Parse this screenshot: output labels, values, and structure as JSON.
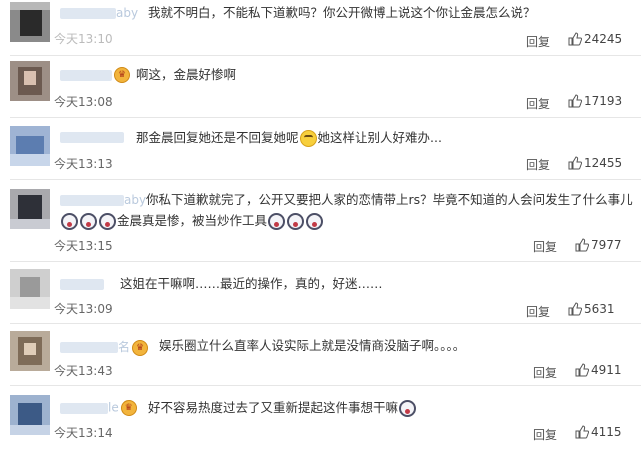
{
  "comments": [
    {
      "user": "aby",
      "vip": false,
      "text_parts": [
        "我就不明白，不能私下道歉吗？你公开微博上说这个你让金晨怎么说？"
      ],
      "emojis_after": [],
      "time": "今天13:10",
      "reply": "回复",
      "likes": "24245"
    },
    {
      "user": "",
      "vip": true,
      "text_parts": [
        "啊这，金晨好惨啊"
      ],
      "emojis_after": [],
      "time": "今天13:08",
      "reply": "回复",
      "likes": "17193"
    },
    {
      "user": "",
      "vip": false,
      "text_parts": [
        "那金晨回复她还是不回复她呢",
        "她这样让别人好难办..."
      ],
      "emojis_after": [],
      "time": "今天13:13",
      "reply": "回复",
      "likes": "12455"
    },
    {
      "user": "aby",
      "vip": false,
      "text_parts": [
        "你私下道歉就完了，公开又要把人家的恋情带上rs？毕竟不知道的人会问发生了什么事儿",
        "金晨真是惨，被当炒作工具"
      ],
      "emojis_after": [],
      "time": "今天13:15",
      "reply": "回复",
      "likes": "7977"
    },
    {
      "user": "",
      "vip": false,
      "text_parts": [
        "这姐在干嘛啊……最近的操作，真的，好迷……"
      ],
      "emojis_after": [],
      "time": "今天13:09",
      "reply": "回复",
      "likes": "5631"
    },
    {
      "user": "名",
      "vip": true,
      "text_parts": [
        "娱乐圈立什么直率人设实际上就是没情商没脑子啊。。。。"
      ],
      "emojis_after": [],
      "time": "今天13:43",
      "reply": "回复",
      "likes": "4911"
    },
    {
      "user": "le",
      "vip": true,
      "text_parts": [
        "好不容易热度过去了又重新提起这件事想干嘛"
      ],
      "emojis_after": [],
      "time": "今天13:14",
      "reply": "回复",
      "likes": "4115"
    }
  ],
  "icons": {
    "like": "thumbs-up-icon",
    "vip": "crown-icon",
    "emoji_shock": "shocked-face-emoji",
    "emoji_smile": "smug-face-emoji"
  },
  "colors": {
    "username": "#b9c9dd",
    "text": "#333333",
    "divider": "#e6e6e6"
  }
}
